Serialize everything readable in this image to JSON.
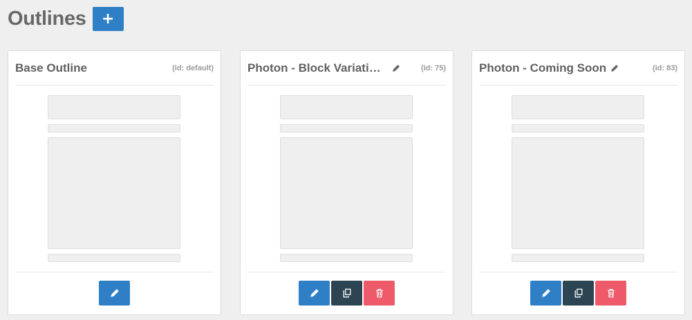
{
  "page": {
    "title": "Outlines",
    "add_label": "+"
  },
  "colors": {
    "primary": "#2f7fc6",
    "dark": "#2d4452",
    "danger": "#ee5a6a",
    "background": "#efefef"
  },
  "outlines": [
    {
      "name": "Base Outline",
      "id_label": "(id: default)",
      "renamable": false,
      "actions": [
        "edit"
      ]
    },
    {
      "name": "Photon - Block Variatio…",
      "id_label": "(id: 75)",
      "renamable": true,
      "actions": [
        "edit",
        "duplicate",
        "delete"
      ]
    },
    {
      "name": "Photon - Coming Soon",
      "id_label": "(id: 83)",
      "renamable": true,
      "actions": [
        "edit",
        "duplicate",
        "delete"
      ]
    }
  ]
}
